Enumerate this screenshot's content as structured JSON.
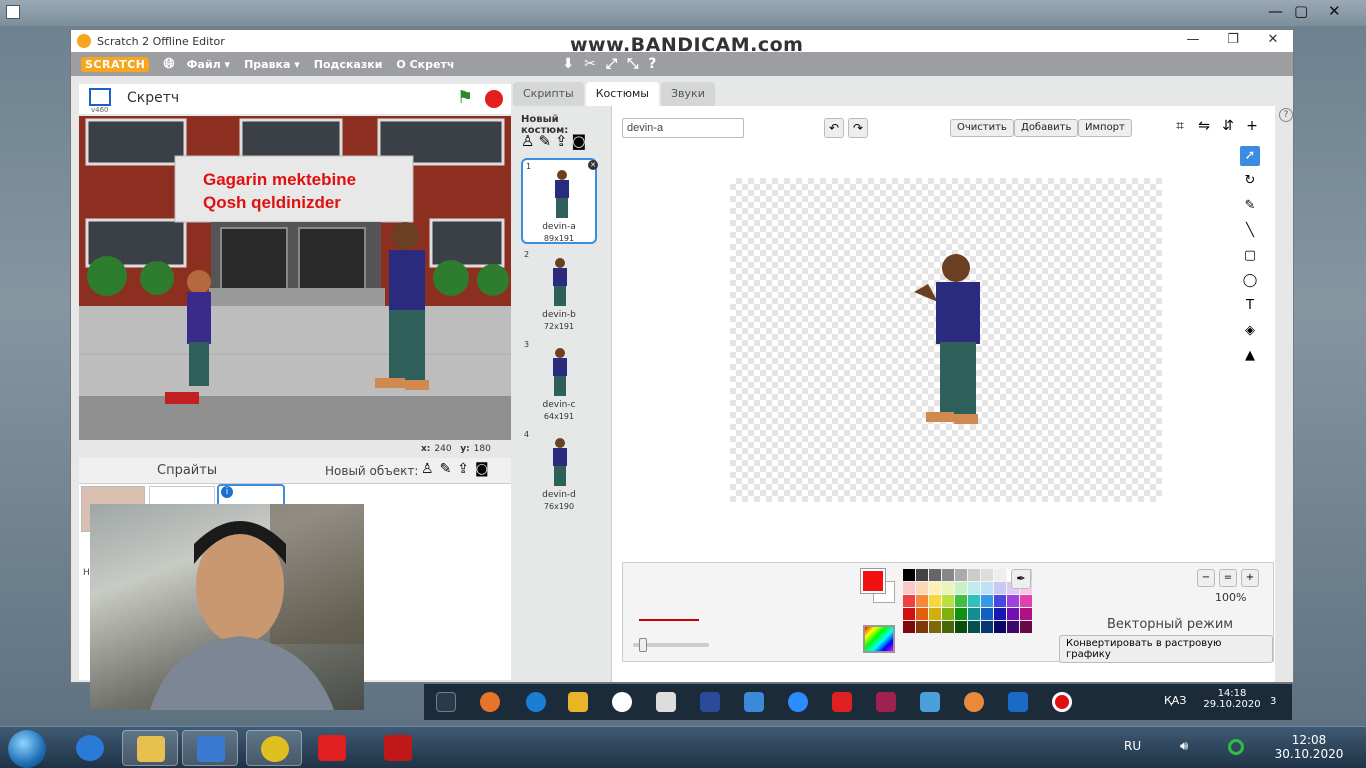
{
  "window": {
    "title": "Scratch 2 Offline Editor",
    "controls": [
      "—",
      "❐",
      "✕"
    ]
  },
  "watermark": "www.BANDICAM.com",
  "menu": {
    "logo": "SCRATCH",
    "file": "Файл ▾",
    "edit": "Правка ▾",
    "tips": "Подсказки",
    "about": "О Скретч"
  },
  "stage": {
    "project_name": "Скретч",
    "version": "v460",
    "banner_line1": "Gagarin mektebine",
    "banner_line2": "Qosh qeldinizder",
    "x_label": "x:",
    "x_value": "240",
    "y_label": "y:",
    "y_value": "180"
  },
  "sprites": {
    "title": "Спрайты",
    "new_object": "Новый объект:",
    "info_badge": "i",
    "partial_label": "Но"
  },
  "tabs": {
    "scripts": "Скрипты",
    "costumes": "Костюмы",
    "sounds": "Звуки"
  },
  "costumes": {
    "new_label": "Новый костюм:",
    "items": [
      {
        "num": "1",
        "name": "devin-a",
        "size": "89x191"
      },
      {
        "num": "2",
        "name": "devin-b",
        "size": "72x191"
      },
      {
        "num": "3",
        "name": "devin-c",
        "size": "64x191"
      },
      {
        "num": "4",
        "name": "devin-d",
        "size": "76x190"
      }
    ]
  },
  "editor": {
    "costume_name": "devin-a",
    "clear": "Очистить",
    "add": "Добавить",
    "import": "Импорт",
    "zoom": "100%",
    "mode": "Векторный режим",
    "convert": "Конвертировать в растровую графику",
    "primary_color": "#f01010"
  },
  "inner_taskbar": {
    "lang": "ҚАЗ",
    "time": "14:18",
    "date": "29.10.2020",
    "notifications": "3"
  },
  "outer_taskbar": {
    "lang": "RU",
    "time": "12:08",
    "date": "30.10.2020"
  }
}
